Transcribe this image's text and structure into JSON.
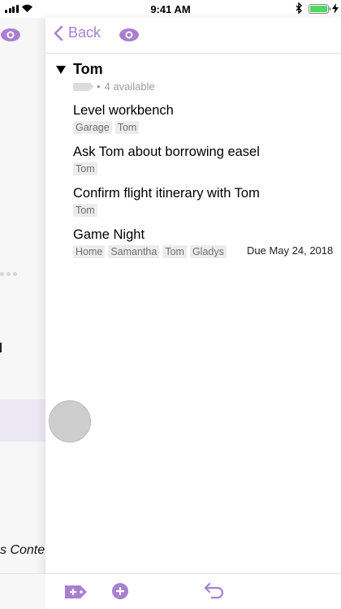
{
  "status_bar": {
    "time": "9:41 AM"
  },
  "colors": {
    "accent": "#a97fd0",
    "tag_bg": "#ececec",
    "tag_text": "#6f6f6f",
    "battery": "#4cd964"
  },
  "nav": {
    "back_label": "Back"
  },
  "group": {
    "title": "Tom",
    "available_text": "4 available"
  },
  "tasks": [
    {
      "title": "Level workbench",
      "tags": [
        "Garage",
        "Tom"
      ]
    },
    {
      "title": "Ask Tom about borrowing easel",
      "tags": [
        "Tom"
      ]
    },
    {
      "title": "Confirm flight itinerary with Tom",
      "tags": [
        "Tom"
      ]
    },
    {
      "title": "Game Night",
      "tags": [
        "Home",
        "Samantha",
        "Tom",
        "Gladys"
      ],
      "due": "Due May 24, 2018"
    }
  ],
  "background_panel": {
    "partial_text": "s Conte"
  },
  "icons": {
    "nav_eye": "eye-icon",
    "toolbar_tag": "add-tag-icon",
    "toolbar_add": "add-icon",
    "toolbar_undo": "undo-icon"
  }
}
